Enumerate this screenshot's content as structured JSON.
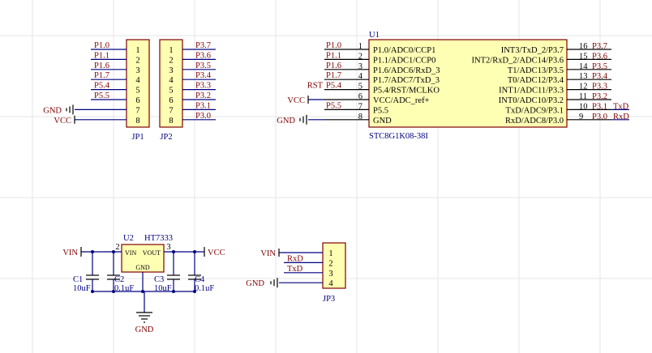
{
  "jp1": {
    "ref": "JP1",
    "pins": [
      {
        "num": "1",
        "net": "P1.0"
      },
      {
        "num": "2",
        "net": "P1.1"
      },
      {
        "num": "3",
        "net": "P1.6"
      },
      {
        "num": "4",
        "net": "P1.7"
      },
      {
        "num": "5",
        "net": "P5.4"
      },
      {
        "num": "6",
        "net": "P5.5"
      },
      {
        "num": "7",
        "net": "GND"
      },
      {
        "num": "8",
        "net": "VCC"
      }
    ]
  },
  "jp2": {
    "ref": "JP2",
    "pins": [
      {
        "num": "1",
        "net": "P3.7"
      },
      {
        "num": "2",
        "net": "P3.6"
      },
      {
        "num": "3",
        "net": "P3.5"
      },
      {
        "num": "4",
        "net": "P3.4"
      },
      {
        "num": "5",
        "net": "P3.3"
      },
      {
        "num": "6",
        "net": "P3.2"
      },
      {
        "num": "7",
        "net": "P3.1"
      },
      {
        "num": "8",
        "net": "P3.0"
      }
    ]
  },
  "u1": {
    "ref": "U1",
    "part": "STC8G1K08-38I",
    "left": [
      {
        "num": "1",
        "name": "P1.0/ADC0/CCP1",
        "net": "P1.0"
      },
      {
        "num": "2",
        "name": "P1.1/ADC1/CCP0",
        "net": "P1.1"
      },
      {
        "num": "3",
        "name": "P1.6/ADC6/RxD_3",
        "net": "P1.6"
      },
      {
        "num": "4",
        "name": "P1.7/ADC7/TxD_3",
        "net": "P1.7"
      },
      {
        "num": "5",
        "name": "P5.4/RST/MCLKO",
        "net": "P5.4",
        "extra": "RST"
      },
      {
        "num": "6",
        "name": "VCC/ADC_ref+",
        "net": "VCC"
      },
      {
        "num": "7",
        "name": "P5.5",
        "net": "P5.5"
      },
      {
        "num": "8",
        "name": "GND",
        "net": "GND"
      }
    ],
    "right": [
      {
        "num": "16",
        "name": "INT3/TxD_2/P3.7",
        "net": "P3.7"
      },
      {
        "num": "15",
        "name": "INT2/RxD_2/ADC14/P3.6",
        "net": "P3.6"
      },
      {
        "num": "14",
        "name": "T1/ADC13/P3.5",
        "net": "P3.5"
      },
      {
        "num": "13",
        "name": "T0/ADC12/P3.4",
        "net": "P3.4"
      },
      {
        "num": "12",
        "name": "INT1/ADC11/P3.3",
        "net": "P3.3"
      },
      {
        "num": "11",
        "name": "INT0/ADC10/P3.2",
        "net": "P3.2"
      },
      {
        "num": "10",
        "name": "TxD/ADC9/P3.1",
        "net": "P3.1",
        "extra": "TxD"
      },
      {
        "num": "9",
        "name": "RxD/ADC8/P3.0",
        "net": "P3.0",
        "extra": "RxD"
      }
    ]
  },
  "reg": {
    "ref": "U2",
    "part": "HT7333",
    "vin_pin": "VIN",
    "vout_pin": "VOUT",
    "gnd_pin": "GND",
    "pin_vin_num": "2",
    "pin_vout_num": "3",
    "in_net": "VIN",
    "out_net": "VCC",
    "gnd_net": "GND",
    "caps": [
      {
        "ref": "C1",
        "value": "10uF"
      },
      {
        "ref": "C2",
        "value": "0.1uF"
      },
      {
        "ref": "C3",
        "value": "10uF"
      },
      {
        "ref": "C4",
        "value": "0.1uF"
      }
    ]
  },
  "jp3": {
    "ref": "JP3",
    "pins": [
      {
        "num": "1",
        "net": "VIN"
      },
      {
        "num": "2",
        "net": "RxD"
      },
      {
        "num": "3",
        "net": "TxD"
      },
      {
        "num": "4",
        "net": "GND"
      }
    ]
  }
}
